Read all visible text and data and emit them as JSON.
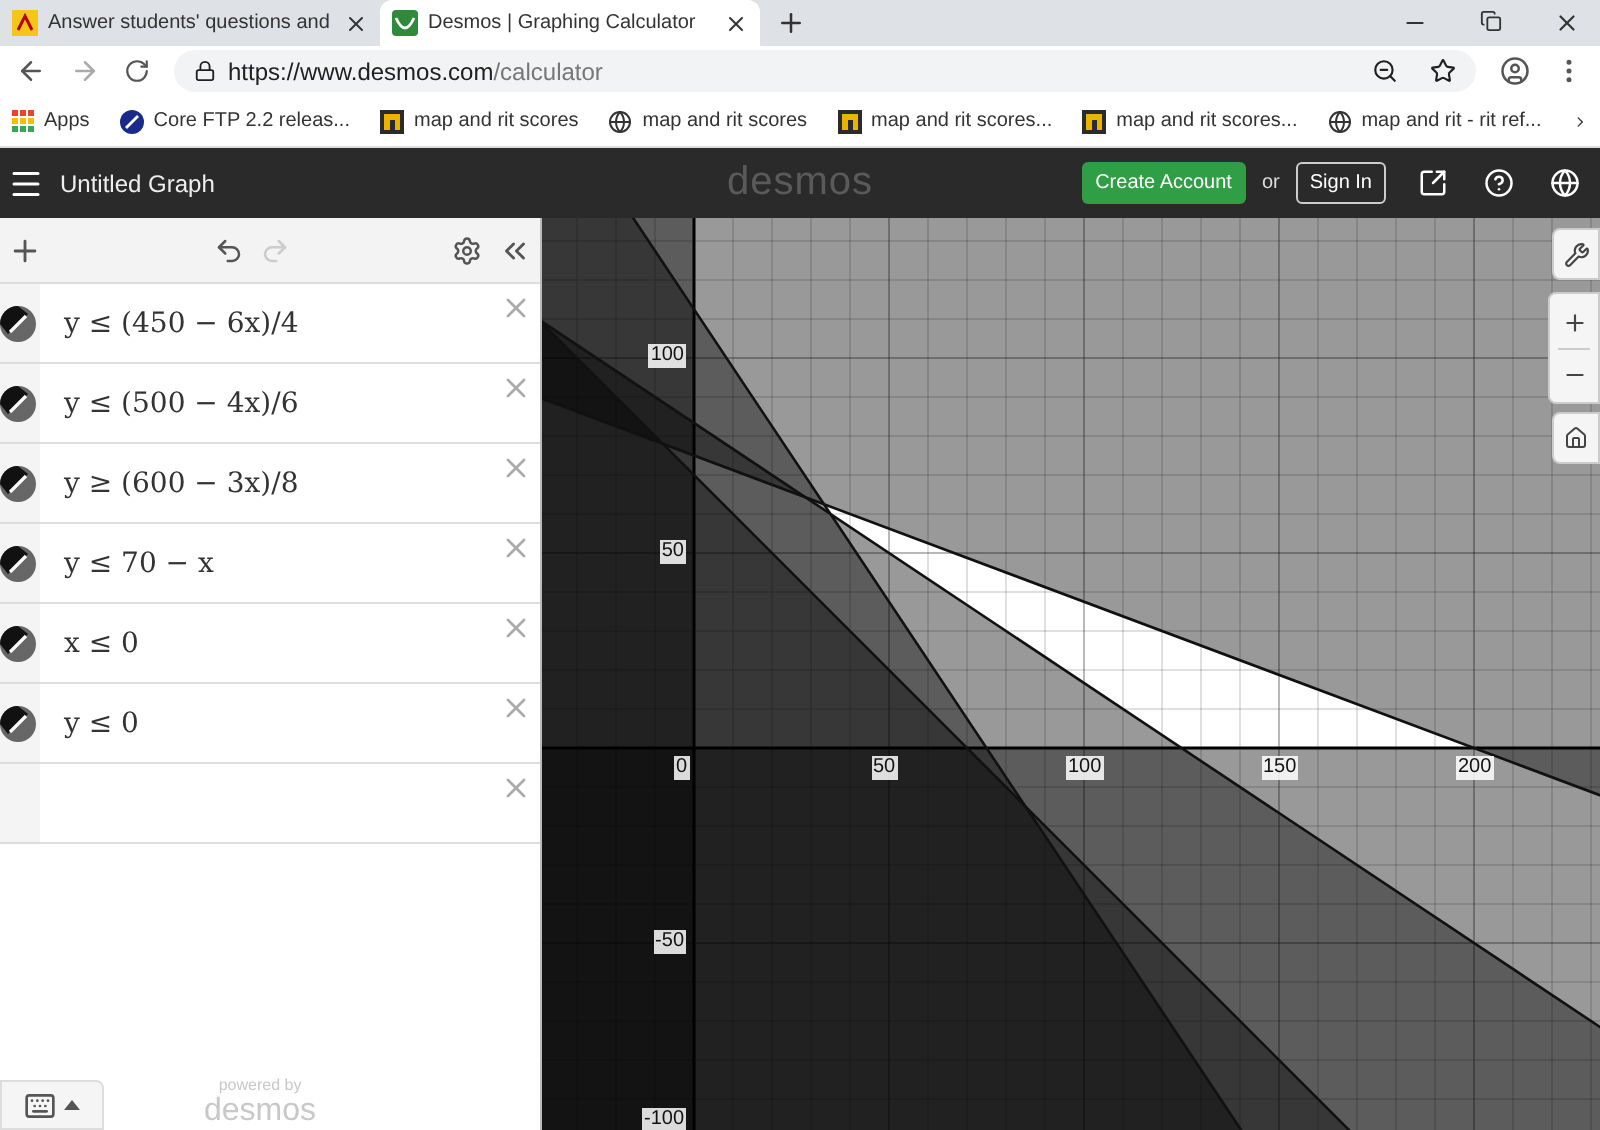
{
  "browser": {
    "tabs": [
      {
        "title": "Answer students' questions and",
        "kind": "letter",
        "selected": false
      },
      {
        "title": "Desmos | Graphing Calculator",
        "kind": "desmos",
        "selected": true
      }
    ],
    "url": {
      "host": "https://www.desmos.com",
      "path": "/calculator"
    },
    "bookmarks": [
      {
        "label": "Apps",
        "kind": "apps"
      },
      {
        "label": "Core FTP 2.2 releas...",
        "kind": "disc"
      },
      {
        "label": "map and rit scores",
        "kind": "tile"
      },
      {
        "label": "map and rit scores",
        "kind": "globe"
      },
      {
        "label": "map and rit scores...",
        "kind": "tile"
      },
      {
        "label": "map and rit scores...",
        "kind": "tile"
      },
      {
        "label": "map and rit - rit ref...",
        "kind": "globe"
      }
    ]
  },
  "header": {
    "title": "Untitled Graph",
    "logo": "desmos",
    "create_account": "Create Account",
    "or": "or",
    "sign_in": "Sign In"
  },
  "expressions": [
    {
      "text": "y ≤ (450 − 6x)/4"
    },
    {
      "text": "y ≤ (500 − 4x)/6"
    },
    {
      "text": "y ≥ (600 − 3x)/8"
    },
    {
      "text": "y ≤ 70 − x"
    },
    {
      "text": "x ≤ 0"
    },
    {
      "text": "y ≤ 0"
    }
  ],
  "graph": {
    "x_ticks": [
      "0",
      "50",
      "100",
      "150",
      "200"
    ],
    "y_ticks": [
      "100",
      "50",
      "-50",
      "-100"
    ]
  },
  "footer": {
    "powered_by": "powered by",
    "logo": "desmos"
  }
}
